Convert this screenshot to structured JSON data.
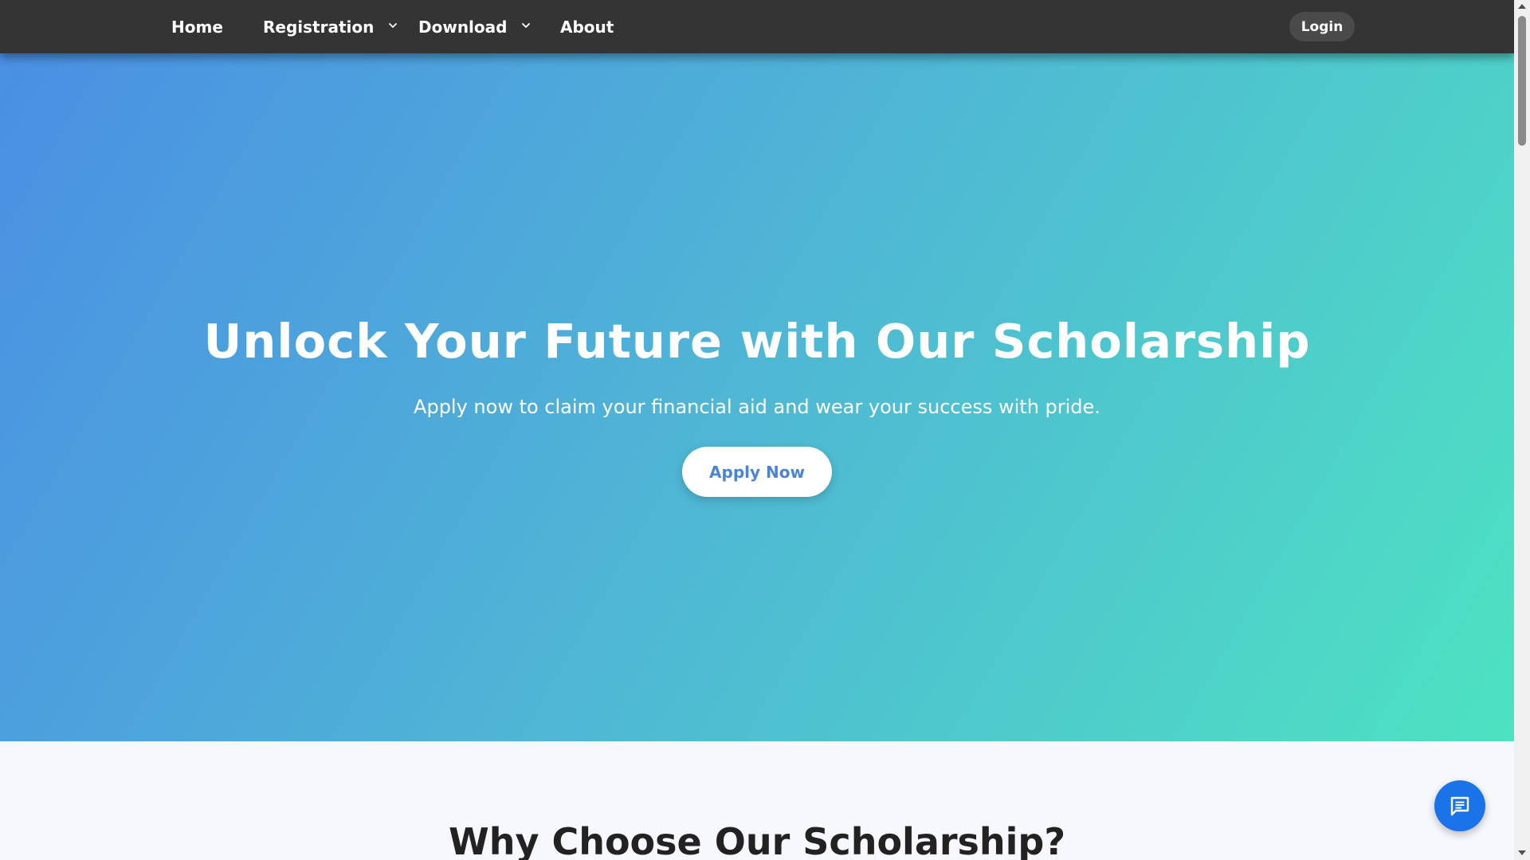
{
  "navbar": {
    "items": [
      {
        "label": "Home",
        "has_dropdown": false
      },
      {
        "label": "Registration",
        "has_dropdown": true
      },
      {
        "label": "Download",
        "has_dropdown": true
      },
      {
        "label": "About",
        "has_dropdown": false
      }
    ],
    "login_label": "Login"
  },
  "hero": {
    "title": "Unlock Your Future with Our Scholarship",
    "subtitle": "Apply now to claim your financial aid and wear your success with pride.",
    "cta_label": "Apply Now"
  },
  "features": {
    "title": "Why Choose Our Scholarship?"
  },
  "chat": {
    "icon": "chat-icon"
  },
  "colors": {
    "navbar_bg": "#343434",
    "hero_gradient_start": "#4a8fe3",
    "hero_gradient_end": "#4de2c1",
    "cta_text": "#4a84d6",
    "chat_button": "#1a73e8",
    "section_bg": "#f7f8fd"
  }
}
